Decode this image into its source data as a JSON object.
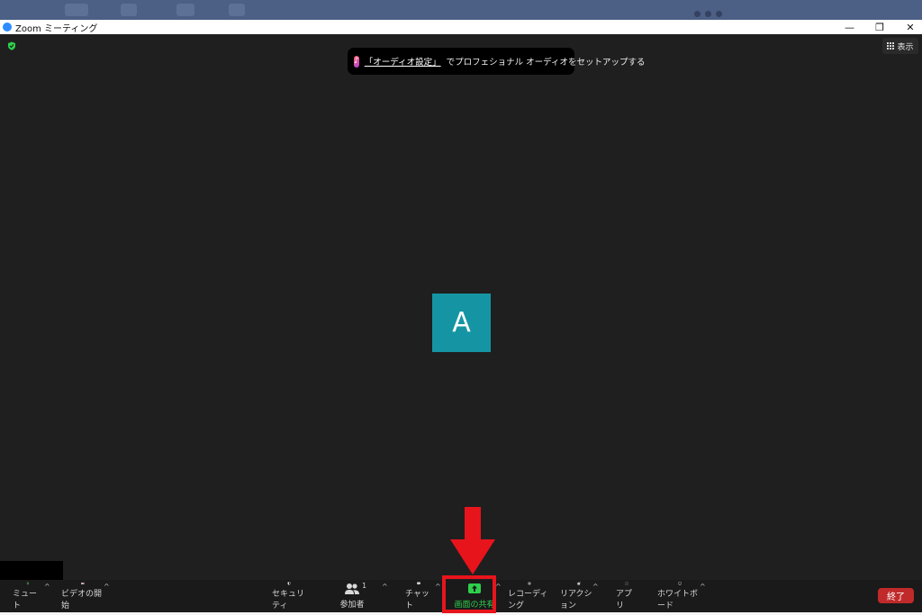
{
  "window": {
    "title": "Zoom ミーティング",
    "controls": {
      "minimize": "—",
      "restore": "❐",
      "close": "✕"
    }
  },
  "meeting": {
    "view_label": "表示",
    "notice": {
      "link_text": "「オーディオ設定」",
      "text": "でプロフェショナル オーディオをセットアップする"
    },
    "avatar_initial": "A"
  },
  "toolbar": {
    "items": [
      {
        "label": "ミュート",
        "icon": "microphone-icon"
      },
      {
        "label": "ビデオの開始",
        "icon": "video-off-icon"
      },
      {
        "label": "セキュリティ",
        "icon": "shield-icon"
      },
      {
        "label": "参加者",
        "icon": "participants-icon",
        "count": "1"
      },
      {
        "label": "チャット",
        "icon": "chat-icon"
      },
      {
        "label": "画面の共有",
        "icon": "share-screen-icon"
      },
      {
        "label": "レコーディング",
        "icon": "record-icon"
      },
      {
        "label": "リアクション",
        "icon": "reaction-icon"
      },
      {
        "label": "アプリ",
        "icon": "apps-icon"
      },
      {
        "label": "ホワイトボード",
        "icon": "whiteboard-icon"
      }
    ],
    "end_label": "終了",
    "caret": "^"
  },
  "colors": {
    "accent_green": "#2dd04b",
    "end_red": "#c12a2a",
    "avatar_teal": "#1595a3",
    "annotation_red": "#e8141c"
  }
}
